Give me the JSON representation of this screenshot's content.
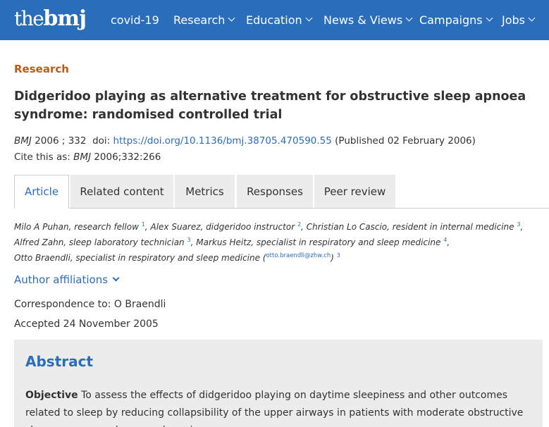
{
  "brand": {
    "logo_the": "the",
    "logo_bmj": "bmj"
  },
  "nav": [
    {
      "label": "covid-19",
      "dropdown": false
    },
    {
      "label": "Research",
      "dropdown": true
    },
    {
      "label": "Education",
      "dropdown": true
    },
    {
      "label": "News & Views",
      "dropdown": true
    },
    {
      "label": "Campaigns",
      "dropdown": true
    },
    {
      "label": "Jobs",
      "dropdown": true
    }
  ],
  "article": {
    "section": "Research",
    "title": "Didgeridoo playing as alternative treatment for obstructive sleep apnoea syndrome: randomised controlled trial",
    "journal": "BMJ",
    "year": "2006",
    "sep": ";",
    "volume": "332",
    "doi_label": "doi:",
    "doi_link": "https://doi.org/10.1136/bmj.38705.470590.55",
    "published": "(Published 02 February 2006)",
    "cite_prefix": "Cite this as:",
    "cite_journal": "BMJ",
    "cite_ref": "2006;332:266"
  },
  "tabs": [
    {
      "label": "Article",
      "active": true
    },
    {
      "label": "Related content",
      "active": false
    },
    {
      "label": "Metrics",
      "active": false
    },
    {
      "label": "Responses",
      "active": false
    },
    {
      "label": "Peer review",
      "active": false
    }
  ],
  "authors": [
    {
      "text": "Milo A Puhan, research fellow",
      "sup": "1",
      "sep": ", "
    },
    {
      "text": "Alex Suarez, didgeridoo instructor",
      "sup": "2",
      "sep": ", "
    },
    {
      "text": "Christian Lo Cascio, resident in internal medicine",
      "sup": "3",
      "sep": ","
    },
    {
      "text": "Alfred Zahn, sleep laboratory technician",
      "sup": "3",
      "sep": ", "
    },
    {
      "text": "Markus Heitz, specialist in respiratory and sleep medicine",
      "sup": "4",
      "sep": ","
    },
    {
      "text": "Otto Braendli, specialist in respiratory and sleep medicine (",
      "email": "otto.braendli@zhw.ch",
      "close": ")",
      "sup": "3",
      "sep": ""
    }
  ],
  "affiliations_label": "Author affiliations",
  "correspondence": "Correspondence to: O Braendli",
  "accepted": "Accepted 24 November 2005",
  "abstract": {
    "title": "Abstract",
    "objective_label": "Objective",
    "objective_text": " To assess the effects of didgeridoo playing on daytime sleepiness and other outcomes related to sleep by reducing collapsibility of the upper airways in patients with moderate obstructive sleep apnoea syndrome and snoring."
  },
  "colors": {
    "nav_bg": "#2a6ebb",
    "link": "#2a6ebb",
    "section": "#b85c1a",
    "tab_bg": "#ececec"
  }
}
